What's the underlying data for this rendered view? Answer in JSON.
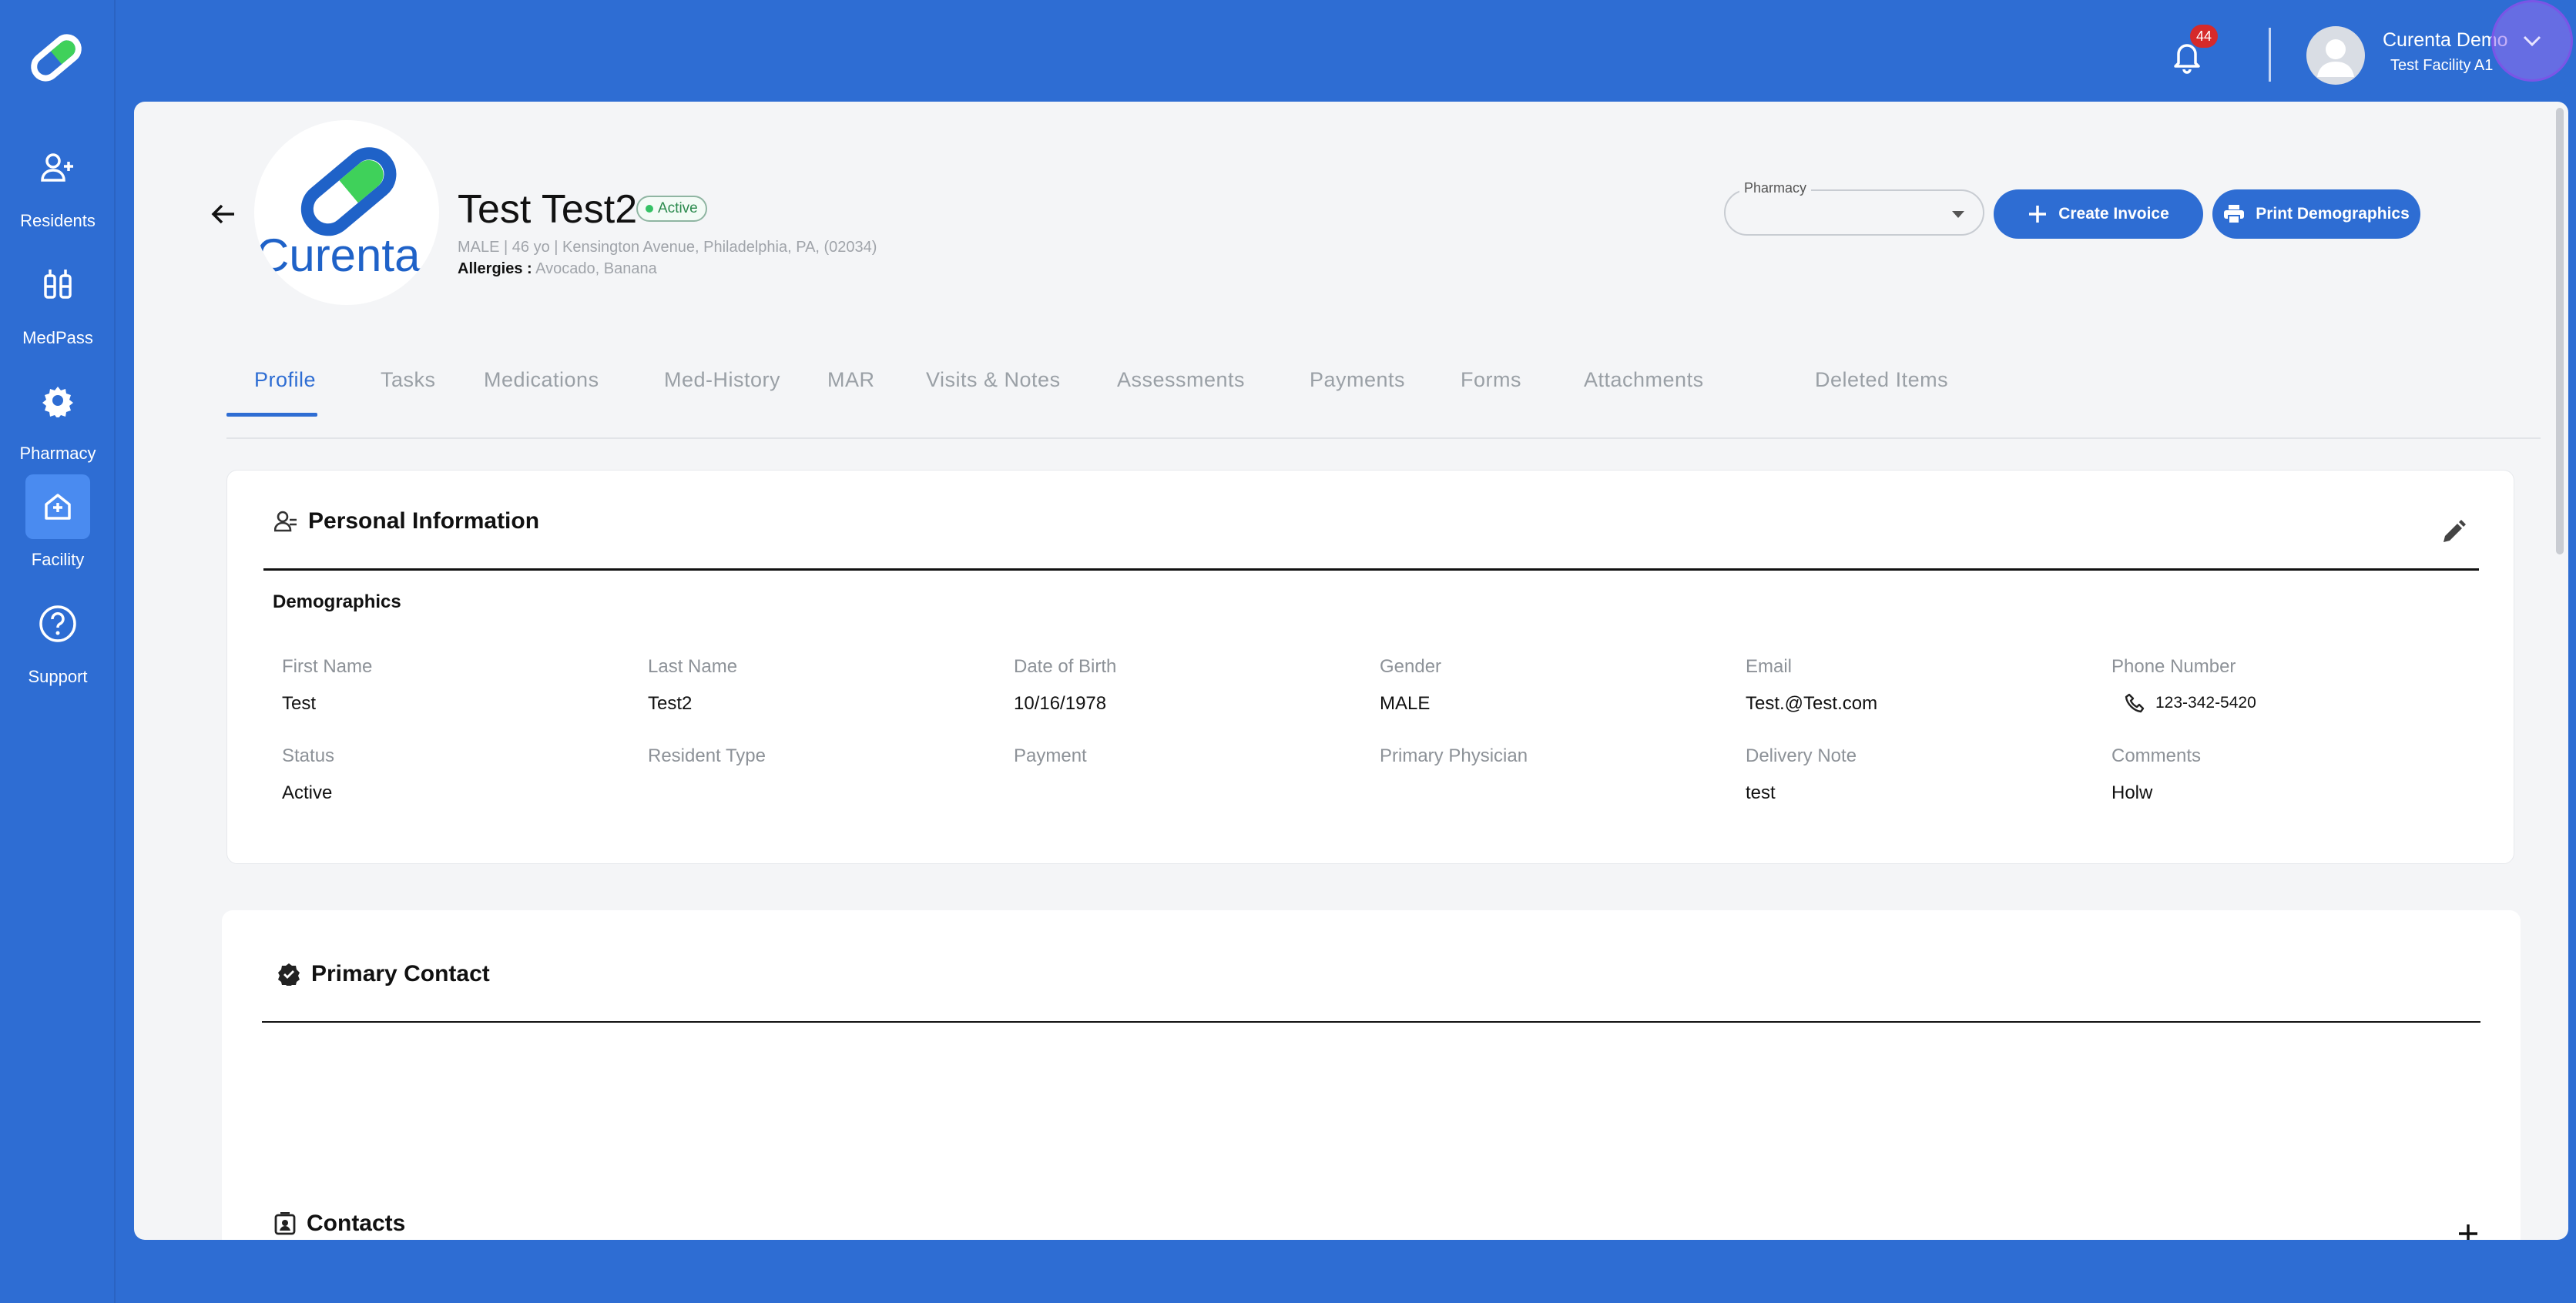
{
  "sidebar": {
    "items": [
      {
        "label": "Residents",
        "icon": "residents-icon"
      },
      {
        "label": "MedPass",
        "icon": "medpass-icon"
      },
      {
        "label": "Pharmacy",
        "icon": "gear-icon"
      },
      {
        "label": "Facility",
        "icon": "facility-icon",
        "active": true
      },
      {
        "label": "Support",
        "icon": "help-icon"
      }
    ]
  },
  "topbar": {
    "notification_count": "44",
    "user_name": "Curenta Demo",
    "user_facility": "Test Facility A1"
  },
  "resident": {
    "logo_text": "Curenta",
    "name": "Test Test2",
    "status": "Active",
    "subline": "MALE | 46 yo | Kensington Avenue, Philadelphia, PA, (02034)",
    "allergies_label": "Allergies :",
    "allergies_value": "Avocado, Banana"
  },
  "actions": {
    "pharmacy_label": "Pharmacy",
    "pharmacy_value": "",
    "create_invoice": "Create Invoice",
    "print_demographics": "Print Demographics"
  },
  "tabs": [
    {
      "label": "Profile",
      "active": true
    },
    {
      "label": "Tasks"
    },
    {
      "label": "Medications"
    },
    {
      "label": "Med-History"
    },
    {
      "label": "MAR"
    },
    {
      "label": "Visits & Notes"
    },
    {
      "label": "Assessments"
    },
    {
      "label": "Payments"
    },
    {
      "label": "Forms"
    },
    {
      "label": "Attachments"
    },
    {
      "label": "Deleted Items"
    }
  ],
  "personal_info": {
    "title": "Personal Information",
    "subheading": "Demographics",
    "row1": [
      {
        "label": "First Name",
        "value": "Test"
      },
      {
        "label": "Last Name",
        "value": "Test2"
      },
      {
        "label": "Date of Birth",
        "value": "10/16/1978"
      },
      {
        "label": "Gender",
        "value": "MALE"
      },
      {
        "label": "Email",
        "value": "Test.@Test.com"
      },
      {
        "label": "Phone Number",
        "value": "123-342-5420"
      }
    ],
    "row2": [
      {
        "label": "Status",
        "value": "Active"
      },
      {
        "label": "Resident Type",
        "value": ""
      },
      {
        "label": "Payment",
        "value": ""
      },
      {
        "label": "Primary Physician",
        "value": ""
      },
      {
        "label": "Delivery Note",
        "value": "test"
      },
      {
        "label": "Comments",
        "value": "Holw"
      }
    ]
  },
  "primary_contact": {
    "title": "Primary Contact"
  },
  "contacts": {
    "title": "Contacts"
  },
  "colors": {
    "brand_blue": "#2e6dd3",
    "active_green": "#35c265",
    "badge_red": "#d62a2a"
  }
}
